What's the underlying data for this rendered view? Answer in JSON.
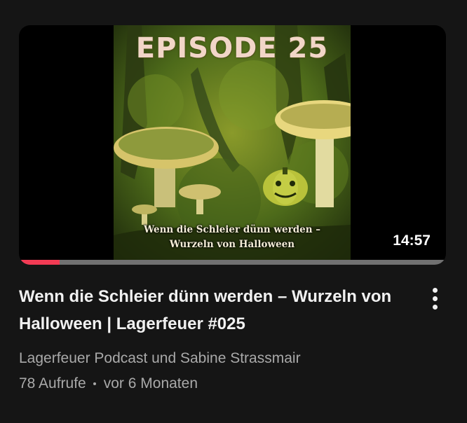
{
  "video": {
    "thumbnail": {
      "episode_text": "EPISODE 25",
      "subtitle_line1": "Wenn die Schleier dünn werden –",
      "subtitle_line2": "Wurzeln von Halloween",
      "duration": "14:57",
      "watch_progress_percent": 9.5
    },
    "title": "Wenn die Schleier dünn werden – Wurzeln von Halloween | Lagerfeuer #025",
    "channel": "Lagerfeuer Podcast und Sabine Strassmair",
    "views": "78 Aufrufe",
    "age": "vor 6 Monaten",
    "menu_icon": "more-vert-icon"
  },
  "colors": {
    "background": "#151515",
    "progress_fill": "#f23b54",
    "progress_track": "#717171",
    "secondary_text": "#a9a9a9"
  }
}
